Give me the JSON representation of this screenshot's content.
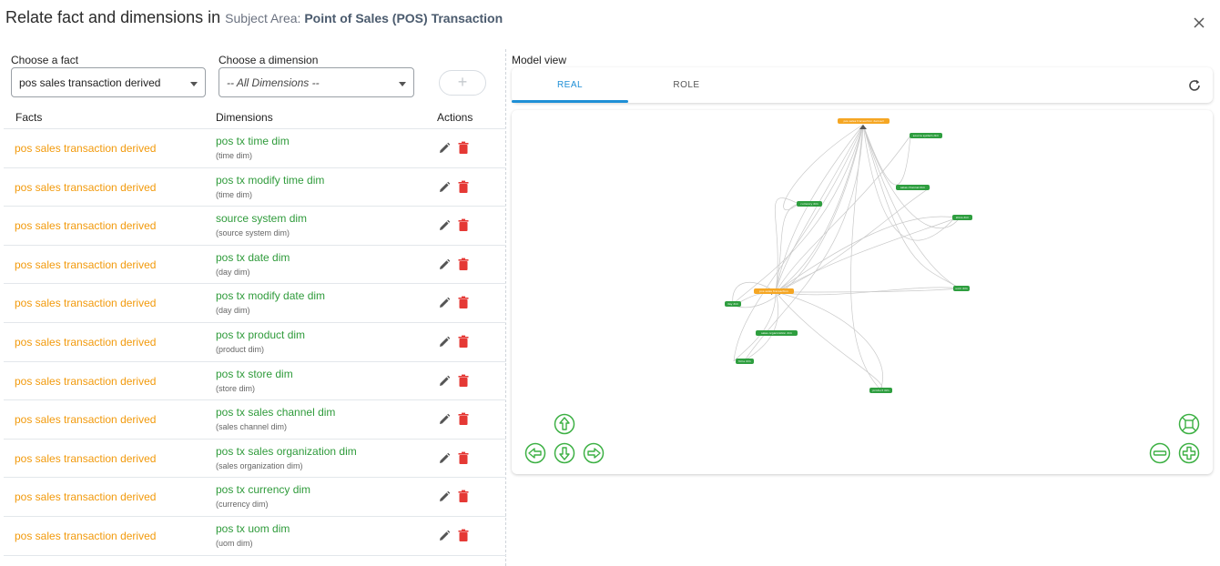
{
  "header": {
    "title": "Relate fact and dimensions in",
    "subject_area_label": "Subject Area:",
    "subject_area_value": "Point of Sales (POS) Transaction"
  },
  "controls": {
    "fact_label": "Choose a fact",
    "fact_value": "pos sales transaction derived",
    "dimension_label": "Choose a dimension",
    "dimension_value": "-- All Dimensions --",
    "add_label": "+"
  },
  "table": {
    "headers": {
      "facts": "Facts",
      "dimensions": "Dimensions",
      "actions": "Actions"
    },
    "rows": [
      {
        "fact": "pos sales transaction derived",
        "dimension": "pos tx time dim",
        "dimension_sub": "(time dim)"
      },
      {
        "fact": "pos sales transaction derived",
        "dimension": "pos tx modify time dim",
        "dimension_sub": "(time dim)"
      },
      {
        "fact": "pos sales transaction derived",
        "dimension": "source system dim",
        "dimension_sub": "(source system dim)"
      },
      {
        "fact": "pos sales transaction derived",
        "dimension": "pos tx date dim",
        "dimension_sub": "(day dim)"
      },
      {
        "fact": "pos sales transaction derived",
        "dimension": "pos tx modify date dim",
        "dimension_sub": "(day dim)"
      },
      {
        "fact": "pos sales transaction derived",
        "dimension": "pos tx product dim",
        "dimension_sub": "(product dim)"
      },
      {
        "fact": "pos sales transaction derived",
        "dimension": "pos tx store dim",
        "dimension_sub": "(store dim)"
      },
      {
        "fact": "pos sales transaction derived",
        "dimension": "pos tx sales channel dim",
        "dimension_sub": "(sales channel dim)"
      },
      {
        "fact": "pos sales transaction derived",
        "dimension": "pos tx sales organization dim",
        "dimension_sub": "(sales organization dim)"
      },
      {
        "fact": "pos sales transaction derived",
        "dimension": "pos tx currency dim",
        "dimension_sub": "(currency dim)"
      },
      {
        "fact": "pos sales transaction derived",
        "dimension": "pos tx uom dim",
        "dimension_sub": "(uom dim)"
      }
    ]
  },
  "model_view": {
    "label": "Model view",
    "tabs": [
      "REAL",
      "ROLE"
    ],
    "active_tab": "REAL",
    "graph_nodes": [
      {
        "label": "pos sales transaction derived",
        "kind": "fact",
        "color": "#f5a623"
      },
      {
        "label": "pos sales transaction",
        "kind": "fact",
        "color": "#f5a623"
      },
      {
        "label": "source system dim",
        "kind": "dimension",
        "color": "#2e9e3f"
      },
      {
        "label": "sales channel dim",
        "kind": "dimension",
        "color": "#2e9e3f"
      },
      {
        "label": "currency dim",
        "kind": "dimension",
        "color": "#2e9e3f"
      },
      {
        "label": "store dim",
        "kind": "dimension",
        "color": "#2e9e3f"
      },
      {
        "label": "uom dim",
        "kind": "dimension",
        "color": "#2e9e3f"
      },
      {
        "label": "day dim",
        "kind": "dimension",
        "color": "#2e9e3f"
      },
      {
        "label": "sales organization dim",
        "kind": "dimension",
        "color": "#2e9e3f"
      },
      {
        "label": "time dim",
        "kind": "dimension",
        "color": "#2e9e3f"
      },
      {
        "label": "product dim",
        "kind": "dimension",
        "color": "#2e9e3f"
      }
    ]
  },
  "colors": {
    "fact_text": "#f29a0c",
    "dimension_text": "#2f9b3b",
    "accent": "#1e8fd6",
    "delete_icon": "#e53935",
    "nav_control": "#3cb043"
  },
  "icons": {
    "close": "close-icon",
    "edit": "pencil-icon",
    "delete": "trash-icon",
    "refresh": "refresh-icon",
    "pan_up": "arrow-up-icon",
    "pan_down": "arrow-down-icon",
    "pan_left": "arrow-left-icon",
    "pan_right": "arrow-right-icon",
    "zoom_in": "zoom-in-icon",
    "zoom_out": "zoom-out-icon",
    "fit": "fit-view-icon"
  }
}
